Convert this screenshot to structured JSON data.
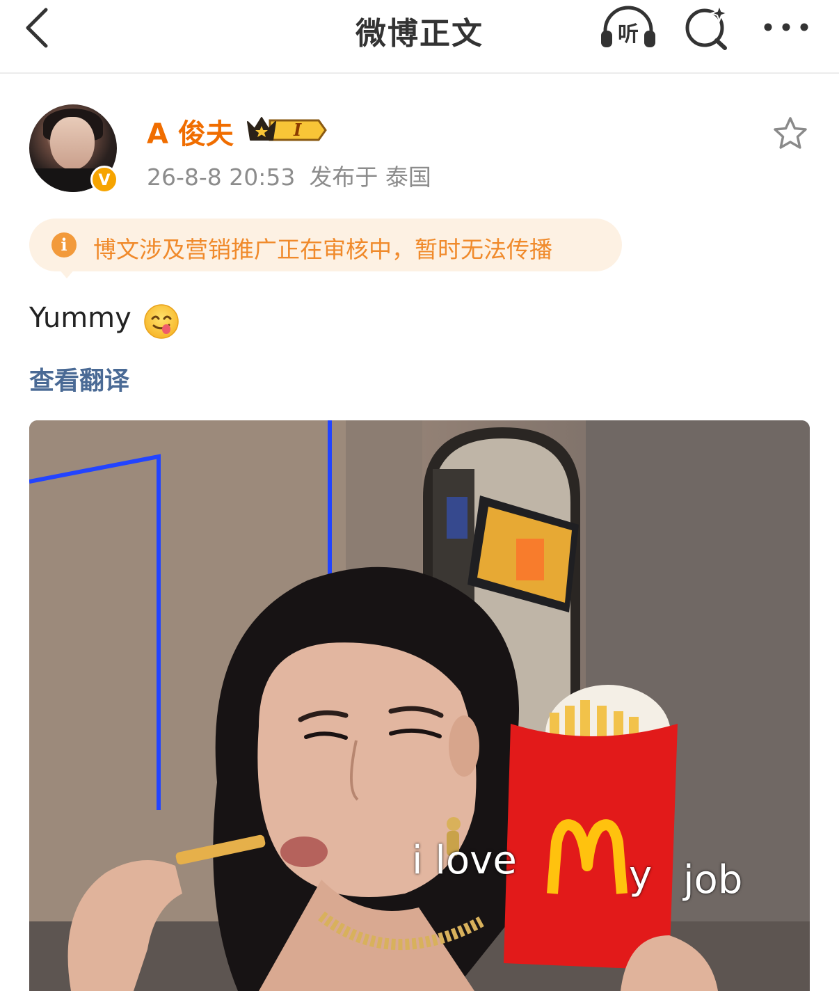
{
  "nav": {
    "title": "微博正文",
    "listen_label": "听",
    "back_icon": "chevron-left-icon",
    "search_icon": "sparkle-search-icon",
    "more_icon": "more-dots-icon"
  },
  "author": {
    "name": "A 俊夫",
    "verified_mark": "V",
    "vip_level": "I",
    "timestamp": "26-8-8 20:53",
    "location": "发布于 泰国"
  },
  "notice": {
    "icon": "info-icon",
    "text": "博文涉及营销推广正在审核中，暂时无法传播"
  },
  "post": {
    "text": "Yummy",
    "emoji": "yummy-face-emoji",
    "translate_label": "查看翻译"
  },
  "photo": {
    "caption_part1": "i love",
    "caption_part2": "y",
    "caption_part3": "job"
  },
  "colors": {
    "accent_orange": "#f06d00",
    "notice_bg": "#fdf1e3",
    "notice_text": "#f08a2b",
    "link_blue": "#4a6a95"
  }
}
